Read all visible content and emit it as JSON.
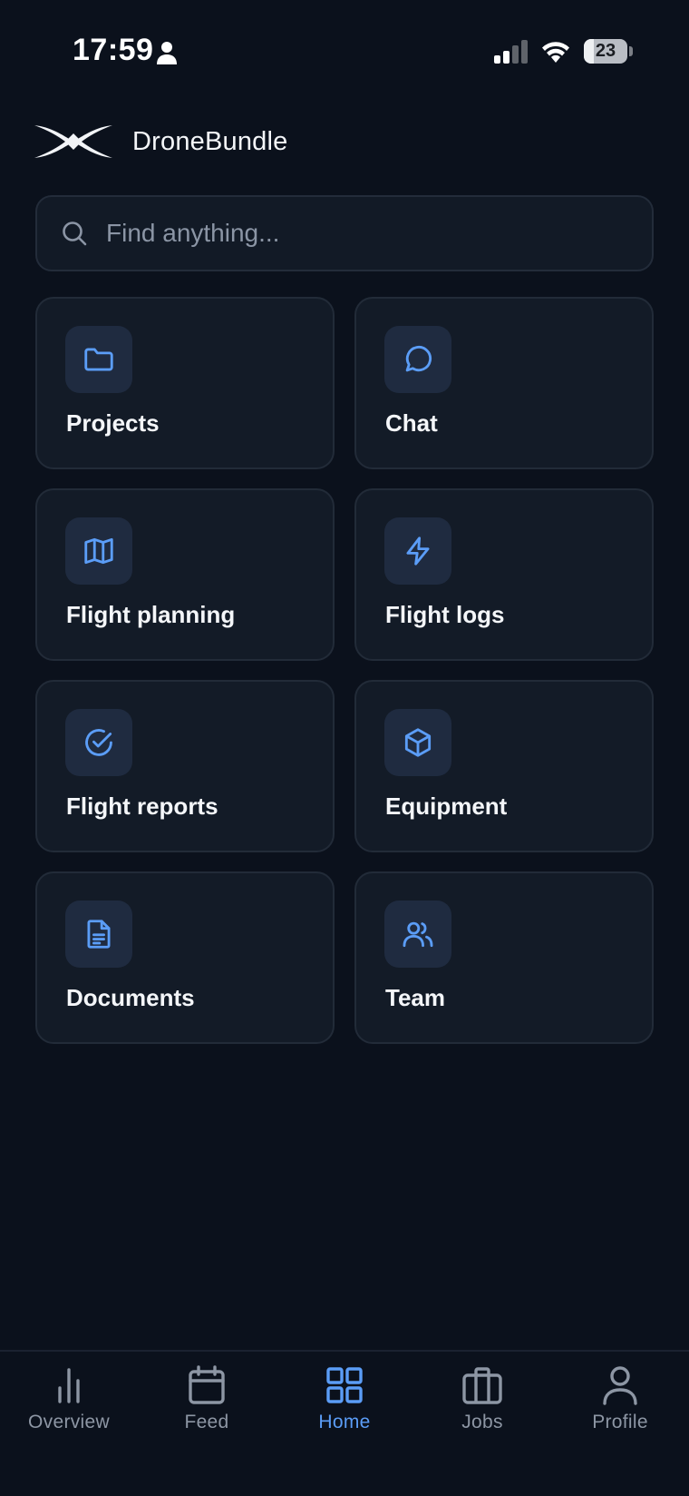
{
  "status_bar": {
    "time": "17:59",
    "battery": "23",
    "battery_level": 0.23
  },
  "brand": {
    "name": "DroneBundle",
    "logo_icon": "drone-x-logo"
  },
  "search": {
    "placeholder": "Find anything...",
    "value": "",
    "icon": "search-icon"
  },
  "tiles": [
    {
      "label": "Projects",
      "icon": "folder-icon"
    },
    {
      "label": "Chat",
      "icon": "chat-bubble-icon"
    },
    {
      "label": "Flight planning",
      "icon": "map-icon"
    },
    {
      "label": "Flight logs",
      "icon": "lightning-icon"
    },
    {
      "label": "Flight reports",
      "icon": "check-circle-icon"
    },
    {
      "label": "Equipment",
      "icon": "box-icon"
    },
    {
      "label": "Documents",
      "icon": "document-icon"
    },
    {
      "label": "Team",
      "icon": "users-icon"
    }
  ],
  "tabbar": {
    "active": "Home",
    "items": [
      {
        "label": "Overview",
        "icon": "bar-chart-icon"
      },
      {
        "label": "Feed",
        "icon": "calendar-icon"
      },
      {
        "label": "Home",
        "icon": "grid-icon"
      },
      {
        "label": "Jobs",
        "icon": "briefcase-icon"
      },
      {
        "label": "Profile",
        "icon": "person-icon"
      }
    ]
  },
  "colors": {
    "background": "#0b111c",
    "tile_background": "#131b27",
    "accent": "#5b9df7",
    "inactive_tab": "#8d96a4"
  }
}
